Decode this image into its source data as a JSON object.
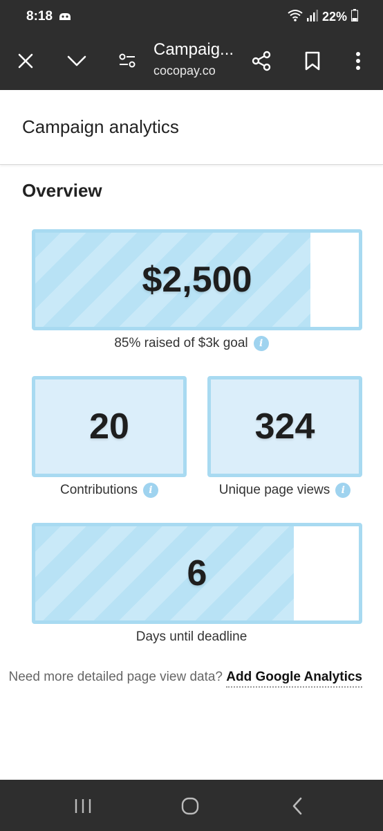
{
  "status_bar": {
    "time": "8:18",
    "battery": "22%",
    "icons": [
      "app-notification-icon",
      "wifi-icon",
      "signal-icon",
      "battery-icon"
    ]
  },
  "toolbar": {
    "title": "Campaig...",
    "url": "cocopay.co",
    "icons": [
      "close-icon",
      "chevron-down-icon",
      "page-settings-icon",
      "share-icon",
      "bookmark-icon",
      "more-icon"
    ]
  },
  "page": {
    "title": "Campaign analytics",
    "section_title": "Overview"
  },
  "stats": {
    "raised": {
      "value": "$2,500",
      "caption": "85% raised of $3k goal",
      "progress": 0.85
    },
    "contributions": {
      "value": "20",
      "caption": "Contributions"
    },
    "page_views": {
      "value": "324",
      "caption": "Unique page views"
    },
    "deadline": {
      "value": "6",
      "caption": "Days until deadline",
      "progress": 0.8
    }
  },
  "footer": {
    "prompt": "Need more detailed page view data?",
    "link": "Add Google Analytics"
  },
  "colors": {
    "accent": "#a8daf1",
    "fill": "#b8e2f5",
    "chrome": "#2e2e2e"
  }
}
